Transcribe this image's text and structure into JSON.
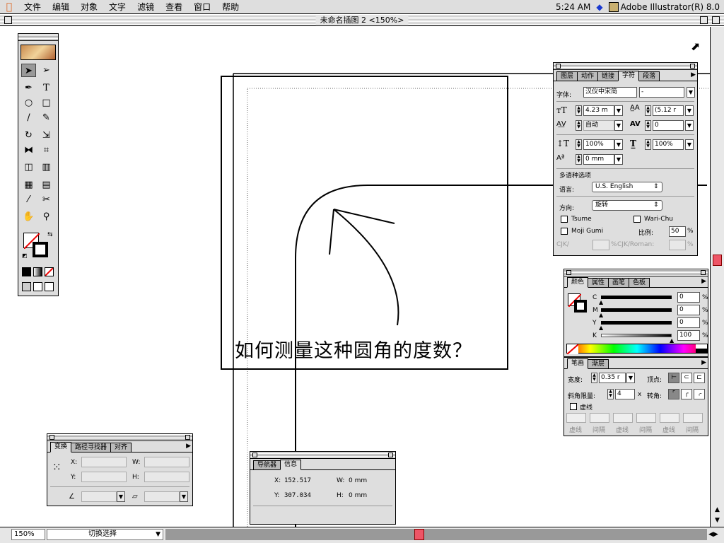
{
  "menubar": {
    "items": [
      "文件",
      "编辑",
      "对象",
      "文字",
      "滤镜",
      "查看",
      "窗口",
      "帮助"
    ],
    "time": "5:24 AM",
    "app_name": "Adobe Illustrator(R) 8.0"
  },
  "window": {
    "title": "未命名插图 2 <150%>"
  },
  "artwork": {
    "question_text": "如何测量这种圆角的度数？"
  },
  "character_panel": {
    "tabs": [
      "图层",
      "动作",
      "链接",
      "字符",
      "段落"
    ],
    "active_tab": "字符",
    "font_label": "字体:",
    "font_value": "汉仪中宋简",
    "font_style_value": "-",
    "size_value": "4.23 m",
    "leading_value": "(5.12 r",
    "kerning_value": "自动",
    "tracking_value": "0",
    "vscale_value": "100%",
    "hscale_value": "100%",
    "baseline_value": "0 mm",
    "multilingual_label": "多语种选项",
    "language_label": "语言:",
    "language_value": "U.S. English",
    "direction_label": "方向:",
    "direction_value": "旋转",
    "tsume_label": "Tsume",
    "warichu_label": "Wari-Chu",
    "mojigumi_label": "Moji Gumi",
    "ratio_label": "比例:",
    "ratio_value": "50",
    "percent": "%",
    "cjk_label": "CJK/",
    "cjk_roman_label": "CJK/Roman:"
  },
  "color_panel": {
    "tabs": [
      "颜色",
      "属性",
      "画笔",
      "色板"
    ],
    "active_tab": "颜色",
    "channels": [
      {
        "label": "C",
        "value": "0",
        "level": 0
      },
      {
        "label": "M",
        "value": "0",
        "level": 0
      },
      {
        "label": "Y",
        "value": "0",
        "level": 0
      },
      {
        "label": "K",
        "value": "100",
        "level": 1
      }
    ],
    "percent": "%"
  },
  "stroke_panel": {
    "tabs": [
      "笔画",
      "渐层"
    ],
    "active_tab": "笔画",
    "weight_label": "宽度:",
    "weight_value": "0.35 r",
    "cap_label": "顶点:",
    "miter_label": "斜角限量:",
    "miter_value": "4",
    "miter_unit": "x",
    "join_label": "转角:",
    "dashed_label": "虚线",
    "dash_labels": [
      "虚线",
      "间隔",
      "虚线",
      "间隔",
      "虚线",
      "间隔"
    ]
  },
  "transform_panel": {
    "tabs": [
      "变换",
      "路径寻找器",
      "对齐"
    ],
    "active_tab": "变换",
    "x_label": "X:",
    "y_label": "Y:",
    "w_label": "W:",
    "h_label": "H:"
  },
  "info_panel": {
    "tabs": [
      "导航器",
      "信息"
    ],
    "active_tab": "信息",
    "x_label": "X:",
    "x_value": "152.517",
    "y_label": "Y:",
    "y_value": "307.034",
    "w_label": "W:",
    "w_value": "0 mm",
    "h_label": "H:",
    "h_value": "0 mm"
  },
  "statusbar": {
    "zoom": "150%",
    "tool_display": "切换选择"
  },
  "colors": {
    "accent_red": "#e05060",
    "menu_blue": "#1a3ad0"
  }
}
